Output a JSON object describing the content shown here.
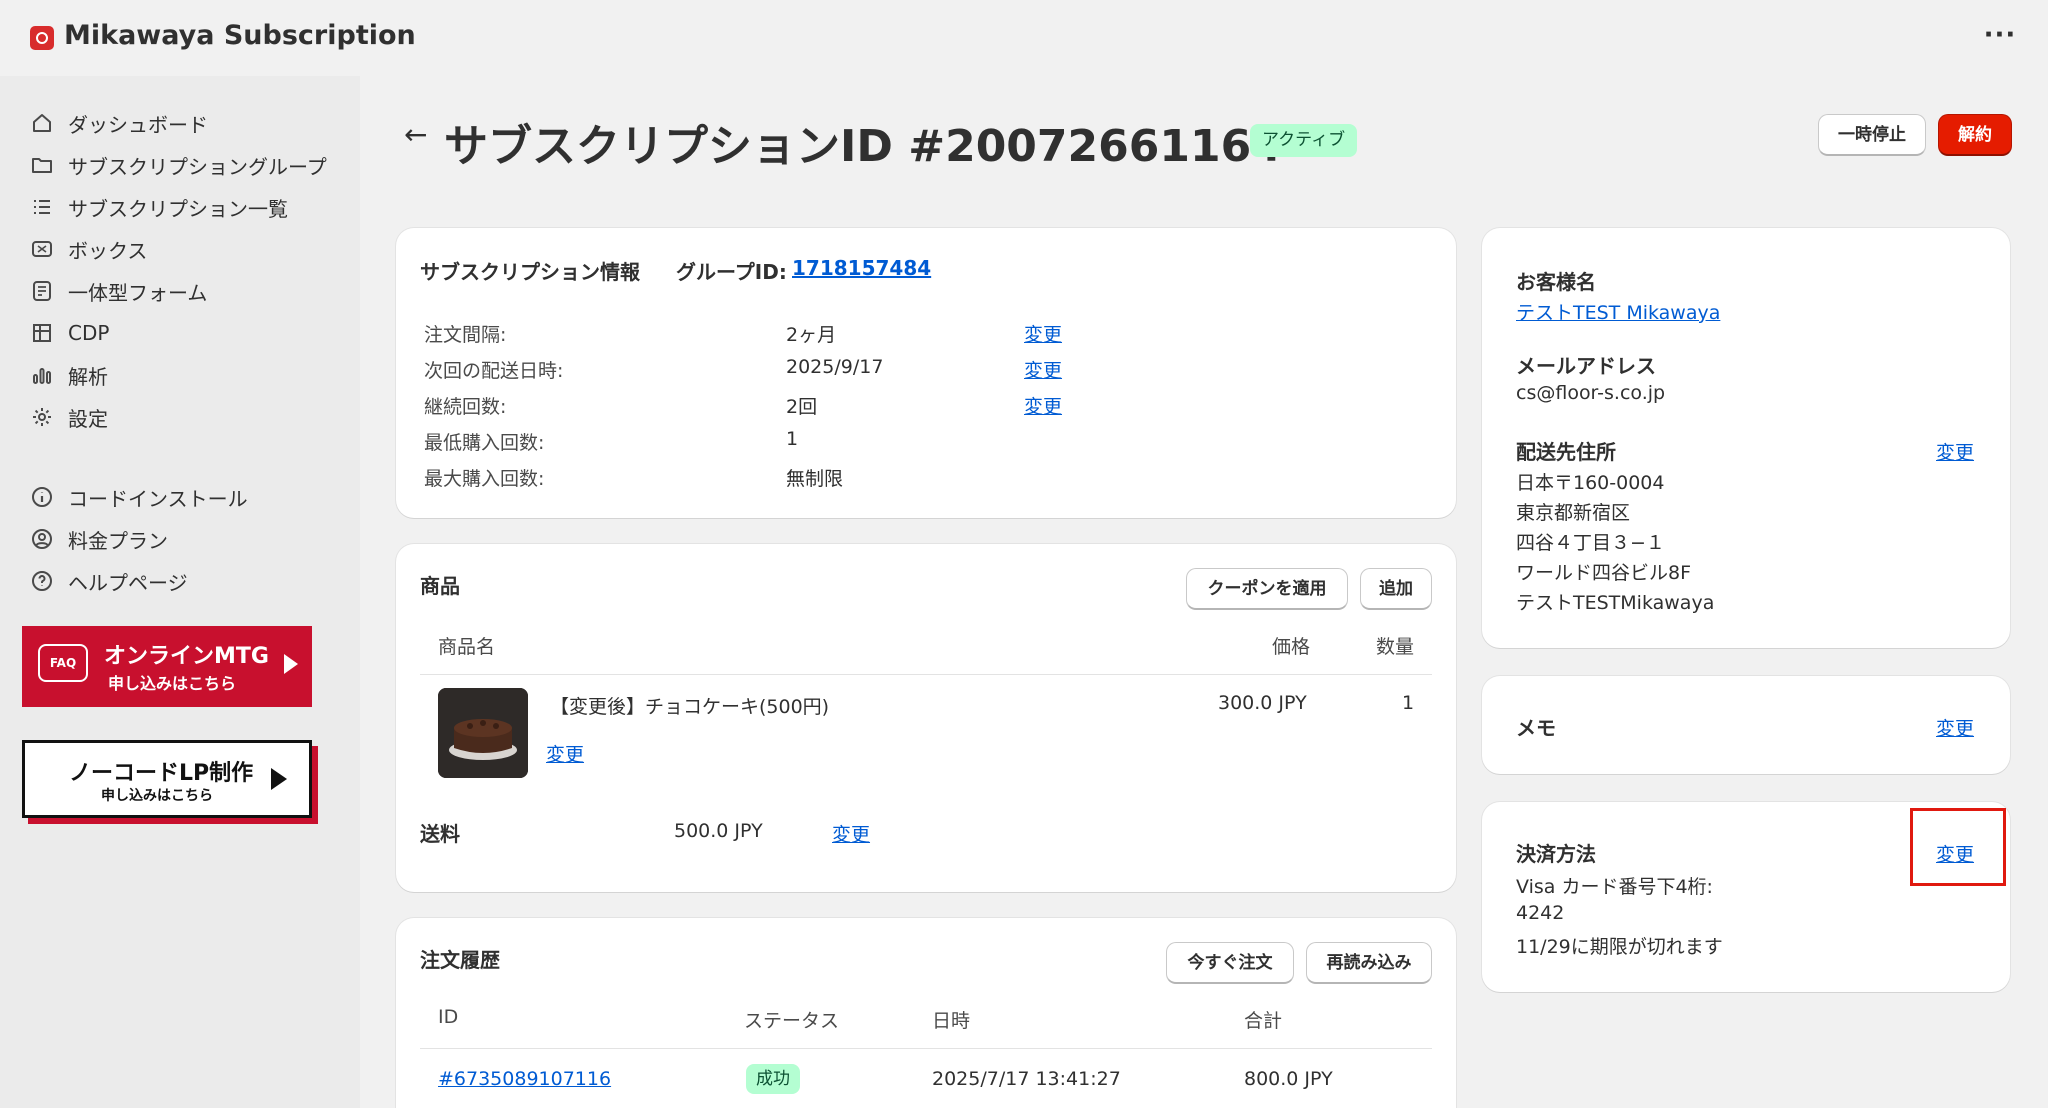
{
  "app": {
    "title": "Mikawaya Subscription",
    "more_label": "···"
  },
  "sidebar": {
    "items": [
      {
        "label": "ダッシュボード",
        "icon": "home-icon"
      },
      {
        "label": "サブスクリプショングループ",
        "icon": "folder-icon"
      },
      {
        "label": "サブスクリプション一覧",
        "icon": "list-icon"
      },
      {
        "label": "ボックス",
        "icon": "box-icon"
      },
      {
        "label": "一体型フォーム",
        "icon": "form-icon"
      },
      {
        "label": "CDP",
        "icon": "grid-icon"
      },
      {
        "label": "解析",
        "icon": "chart-icon"
      },
      {
        "label": "設定",
        "icon": "gear-icon"
      },
      {
        "label": "コードインストール",
        "icon": "info-icon"
      },
      {
        "label": "料金プラン",
        "icon": "user-circle-icon"
      },
      {
        "label": "ヘルプページ",
        "icon": "help-icon"
      }
    ],
    "banner_mtg": {
      "faq": "FAQ",
      "line1": "オンラインMTG",
      "line2": "申し込みはこちら"
    },
    "banner_lp": {
      "line1": "ノーコードLP制作",
      "line2": "申し込みはこちら"
    }
  },
  "header": {
    "title": "サブスクリプションID #20072661164",
    "status": "アクティブ",
    "pause_label": "一時停止",
    "cancel_label": "解約"
  },
  "info": {
    "title": "サブスクリプション情報",
    "group_label": "グループID:",
    "group_id": "1718157484",
    "rows": [
      {
        "label": "注文間隔:",
        "value": "2ヶ月",
        "action": "変更"
      },
      {
        "label": "次回の配送日時:",
        "value": "2025/9/17",
        "action": "変更"
      },
      {
        "label": "継続回数:",
        "value": "2回",
        "action": "変更"
      },
      {
        "label": "最低購入回数:",
        "value": "1",
        "action": ""
      },
      {
        "label": "最大購入回数:",
        "value": "無制限",
        "action": ""
      }
    ]
  },
  "products": {
    "title": "商品",
    "coupon_label": "クーポンを適用",
    "add_label": "追加",
    "col_name": "商品名",
    "col_price": "価格",
    "col_qty": "数量",
    "item": {
      "name": "【変更後】チョコケーキ(500円)",
      "price": "300.0 JPY",
      "qty": "1",
      "action": "変更"
    },
    "shipping_label": "送料",
    "shipping_value": "500.0 JPY",
    "shipping_action": "変更"
  },
  "orders": {
    "title": "注文履歴",
    "order_now_label": "今すぐ注文",
    "reload_label": "再読み込み",
    "col_id": "ID",
    "col_status": "ステータス",
    "col_date": "日時",
    "col_total": "合計",
    "rows": [
      {
        "id": "#6735089107116",
        "status": "成功",
        "date": "2025/7/17 13:41:27",
        "total": "800.0 JPY"
      }
    ]
  },
  "customer": {
    "name_label": "お客様名",
    "name": "テストTEST Mikawaya",
    "email_label": "メールアドレス",
    "email": "cs@floor-s.co.jp",
    "address_label": "配送先住所",
    "address_action": "変更",
    "address_lines": [
      "日本〒160-0004",
      "東京都新宿区",
      "四谷４丁目３−１",
      "ワールド四谷ビル8F",
      "テストTESTMikawaya"
    ]
  },
  "memo": {
    "title": "メモ",
    "action": "変更"
  },
  "payment": {
    "title": "決済方法",
    "action": "変更",
    "line1": "Visa カード番号下4桁:",
    "line2": "4242",
    "line3": "11/29に期限が切れます"
  },
  "colors": {
    "accent": "#005bd3",
    "danger": "#e51c00",
    "success_bg": "#b4fed2",
    "brand_red": "#c8102e"
  }
}
